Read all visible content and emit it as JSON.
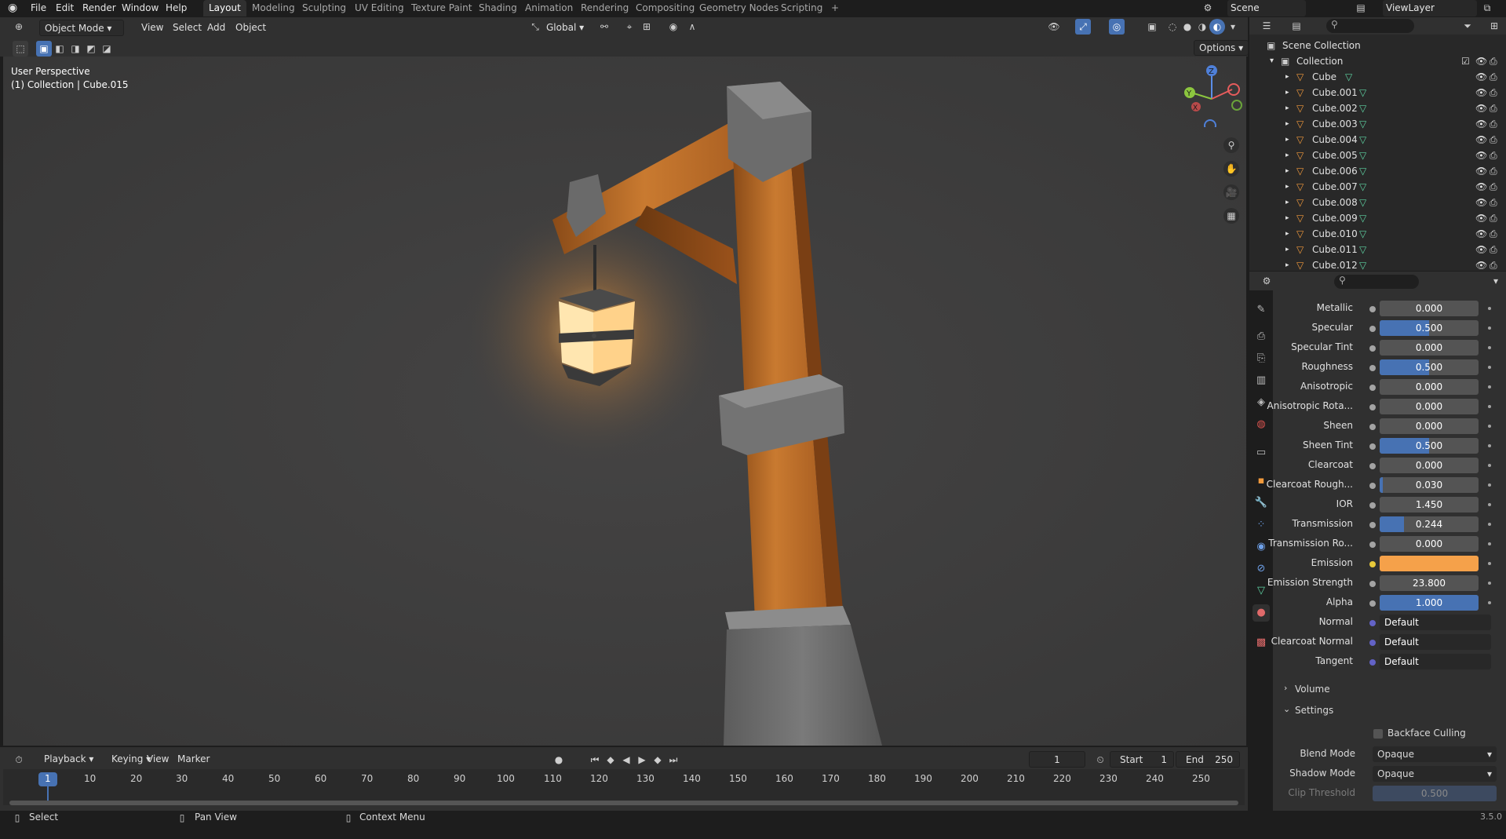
{
  "topbar": {
    "menus": [
      "File",
      "Edit",
      "Render",
      "Window",
      "Help"
    ],
    "workspaces": [
      "Layout",
      "Modeling",
      "Sculpting",
      "UV Editing",
      "Texture Paint",
      "Shading",
      "Animation",
      "Rendering",
      "Compositing",
      "Geometry Nodes",
      "Scripting"
    ],
    "active_workspace": "Layout",
    "add_tab": "+",
    "scene": "Scene",
    "view_layer": "ViewLayer"
  },
  "viewport": {
    "mode": "Object Mode",
    "menus": [
      "View",
      "Select",
      "Add",
      "Object"
    ],
    "orientation": "Global",
    "options_label": "Options",
    "info_line1": "User Perspective",
    "info_line2": "(1) Collection | Cube.015",
    "gizmo_axes": {
      "x": "X",
      "y": "Y",
      "z": "Z"
    }
  },
  "timeline": {
    "menus": [
      "Playback",
      "Keying",
      "View",
      "Marker"
    ],
    "current_frame": "1",
    "start_label": "Start",
    "start": "1",
    "end_label": "End",
    "end": "250",
    "ticks": [
      "1",
      "10",
      "20",
      "30",
      "40",
      "50",
      "60",
      "70",
      "80",
      "90",
      "100",
      "110",
      "120",
      "130",
      "140",
      "150",
      "160",
      "170",
      "180",
      "190",
      "200",
      "210",
      "220",
      "230",
      "240",
      "250"
    ]
  },
  "statusbar": {
    "select": "Select",
    "pan": "Pan View",
    "context": "Context Menu",
    "version": "3.5.0"
  },
  "outliner": {
    "scene_collection": "Scene Collection",
    "collection": "Collection",
    "objects": [
      "Cube",
      "Cube.001",
      "Cube.002",
      "Cube.003",
      "Cube.004",
      "Cube.005",
      "Cube.006",
      "Cube.007",
      "Cube.008",
      "Cube.009",
      "Cube.010",
      "Cube.011",
      "Cube.012"
    ]
  },
  "properties": {
    "rows": [
      {
        "label": "Metallic",
        "value": "0.000",
        "fill": 0
      },
      {
        "label": "Specular",
        "value": "0.500",
        "fill": 0.5
      },
      {
        "label": "Specular Tint",
        "value": "0.000",
        "fill": 0
      },
      {
        "label": "Roughness",
        "value": "0.500",
        "fill": 0.5
      },
      {
        "label": "Anisotropic",
        "value": "0.000",
        "fill": 0
      },
      {
        "label": "Anisotropic Rota...",
        "value": "0.000",
        "fill": 0
      },
      {
        "label": "Sheen",
        "value": "0.000",
        "fill": 0
      },
      {
        "label": "Sheen Tint",
        "value": "0.500",
        "fill": 0.5
      },
      {
        "label": "Clearcoat",
        "value": "0.000",
        "fill": 0
      },
      {
        "label": "Clearcoat Rough...",
        "value": "0.030",
        "fill": 0.03
      },
      {
        "label": "IOR",
        "value": "1.450",
        "fill": 0
      },
      {
        "label": "Transmission",
        "value": "0.244",
        "fill": 0.244
      },
      {
        "label": "Transmission Ro...",
        "value": "0.000",
        "fill": 0
      },
      {
        "label": "Emission",
        "value": "",
        "fill": 0,
        "color": "#f5a14a"
      },
      {
        "label": "Emission Strength",
        "value": "23.800",
        "fill": 0
      },
      {
        "label": "Alpha",
        "value": "1.000",
        "fill": 1
      }
    ],
    "links": [
      {
        "label": "Normal",
        "value": "Default"
      },
      {
        "label": "Clearcoat Normal",
        "value": "Default"
      },
      {
        "label": "Tangent",
        "value": "Default"
      }
    ],
    "volume_label": "Volume",
    "settings_label": "Settings",
    "backface_label": "Backface Culling",
    "blend_mode_label": "Blend Mode",
    "blend_mode": "Opaque",
    "shadow_mode_label": "Shadow Mode",
    "shadow_mode": "Opaque",
    "clip_label": "Clip Threshold",
    "clip_value": "0.500"
  },
  "colors": {
    "accent": "#4772b3",
    "emission": "#f5a14a",
    "mesh_icon": "#5fd3a3",
    "object_icon": "#f29a3c"
  }
}
